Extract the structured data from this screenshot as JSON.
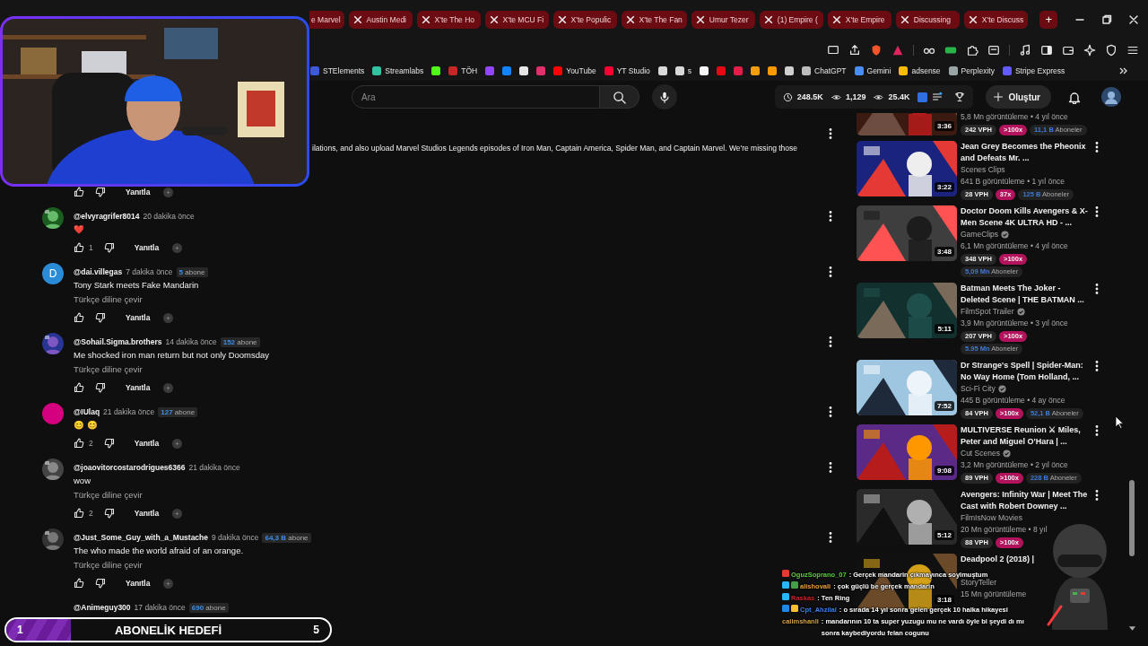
{
  "browser": {
    "tabs": [
      {
        "label": "e Marvel",
        "kind": "cut"
      },
      {
        "label": "Austin Medi",
        "kind": "site"
      },
      {
        "label": "X'te The Ho",
        "kind": "site"
      },
      {
        "label": "X'te MCU Fi",
        "kind": "site"
      },
      {
        "label": "X'te Populic",
        "kind": "site"
      },
      {
        "label": "X'te The Fan",
        "kind": "site"
      },
      {
        "label": "Umur Tezer",
        "kind": "site"
      },
      {
        "label": "(1) Empire (",
        "kind": "site"
      },
      {
        "label": "X'te Empire",
        "kind": "site"
      },
      {
        "label": "Discussing",
        "kind": "site"
      },
      {
        "label": "X'te Discuss",
        "kind": "site"
      }
    ],
    "new_tab": "+",
    "bookmarks": [
      {
        "label": "STElements",
        "color": "#3b5bdb"
      },
      {
        "label": "Streamlabs",
        "color": "#31c3a2"
      },
      {
        "color": "#53fc18"
      },
      {
        "label": "TÖH",
        "color": "#c62828"
      },
      {
        "color": "#9146ff"
      },
      {
        "color": "#1185fe"
      },
      {
        "color": "#e6e6e6"
      },
      {
        "color": "#e1306c"
      },
      {
        "label": "YouTube",
        "color": "#ff0000"
      },
      {
        "label": "YT Studio",
        "color": "#ff0033"
      },
      {
        "color": "#d9d9d9"
      },
      {
        "label": "s",
        "color": "#d9d9d9"
      },
      {
        "color": "#f5f5f5"
      },
      {
        "color": "#e50914"
      },
      {
        "color": "#e11d48"
      },
      {
        "color": "#f59e0b"
      },
      {
        "color": "#ff9900"
      },
      {
        "color": "#cfcfcf"
      },
      {
        "label": "ChatGPT",
        "color": "#bdbdbd"
      },
      {
        "label": "Gemini",
        "color": "#4b8df8"
      },
      {
        "label": "adsense",
        "color": "#fbbc04"
      },
      {
        "label": "Perplexity",
        "color": "#9aa5a6"
      },
      {
        "label": "Stripe Express",
        "color": "#635bff"
      }
    ]
  },
  "masthead": {
    "search": {
      "placeholder": "Ara"
    },
    "stats": [
      {
        "kind": "clock",
        "value": "248.5K"
      },
      {
        "kind": "eye",
        "value": "1,129"
      },
      {
        "kind": "eye",
        "value": "25.4K"
      }
    ],
    "create": "Oluştur"
  },
  "comments": [
    {
      "text": "ilations, and also upload Marvel Studios Legends episodes of Iron Man, Captain America, Spider Man, and Captain Marvel. We're missing those",
      "reply": "Yanıtla",
      "menu": true
    },
    {
      "author": "@elvyragrifer8014",
      "time": "20 dakika önce",
      "text": "❤️",
      "likes": "1",
      "reply": "Yanıtla",
      "menu": true
    },
    {
      "author": "@dai.villegas",
      "time": "7 dakika önce",
      "subscribers": {
        "count": "5",
        "unit": "abone"
      },
      "avatar": {
        "kind": "letter",
        "letter": "D",
        "color": "#2a8bd6"
      },
      "text": "Tony Stark meets Fake Mandarin",
      "translate": "Türkçe diline çevir",
      "reply": "Yanıtla",
      "menu": true
    },
    {
      "author": "@Sohail.Sigma.brothers",
      "time": "14 dakika önce",
      "subscribers": {
        "count": "152",
        "unit": "abone"
      },
      "text": "Me shocked iron man return but not only Doomsday",
      "translate": "Türkçe diline çevir",
      "reply": "Yanıtla",
      "menu": true
    },
    {
      "author": "@IUlaq",
      "time": "21 dakika önce",
      "subscribers": {
        "count": "127",
        "unit": "abone"
      },
      "avatar": {
        "kind": "plain",
        "color": "#d5007f"
      },
      "text": "😊 😊",
      "likes": "2",
      "reply": "Yanıtla",
      "menu": true
    },
    {
      "author": "@joaovitorcostarodrigues6366",
      "time": "21 dakika önce",
      "text": "wow",
      "translate": "Türkçe diline çevir",
      "likes": "2",
      "reply": "Yanıtla",
      "menu": true
    },
    {
      "author": "@Just_Some_Guy_with_a_Mustache",
      "time": "9 dakika önce",
      "subscribers": {
        "count": "64,3 B",
        "unit": "abone"
      },
      "text": "The who made the world afraid of an orange.",
      "translate": "Türkçe diline çevir",
      "reply": "Yanıtla",
      "menu": true
    },
    {
      "author": "@Animeguy300",
      "time": "17 dakika önce",
      "subscribers": {
        "count": "690",
        "unit": "abone"
      },
      "menu": false
    }
  ],
  "videos": [
    {
      "duration": "3:36",
      "meta": "5,8 Mn görüntüleme • 4 yıl önce",
      "vph": "242 VPH",
      "multiplier": ">100x",
      "subs_count": "11,1 B",
      "subs_unit": "Aboneler",
      "menu": false
    },
    {
      "title": "Jean Grey Becomes the Pheonix and Defeats Mr. ...",
      "channel": "Scenes Clips",
      "verified": false,
      "duration": "3:22",
      "meta": "641 B görüntüleme • 1 yıl önce",
      "vph": "28 VPH",
      "multiplier": "37x",
      "subs_count": "125 B",
      "subs_unit": "Aboneler",
      "menu": true
    },
    {
      "title": "Doctor Doom Kills Avengers & X-Men Scene 4K ULTRA HD - ...",
      "channel": "GameClips",
      "verified": true,
      "duration": "3:48",
      "meta": "6,1 Mn görüntüleme • 4 yıl önce",
      "vph": "348 VPH",
      "multiplier": ">100x",
      "subs_count": "5,09 Mn",
      "subs_unit": "Aboneler",
      "menu": true
    },
    {
      "title": "Batman Meets The Joker - Deleted Scene | THE BATMAN ...",
      "channel": "FilmSpot Trailer",
      "verified": true,
      "duration": "5:11",
      "meta": "3,9 Mn görüntüleme • 3 yıl önce",
      "vph": "207 VPH",
      "multiplier": ">100x",
      "subs_count": "5.95 Mn",
      "subs_unit": "Aboneler",
      "menu": true
    },
    {
      "title": "Dr Strange's Spell | Spider-Man: No Way Home (Tom Holland, ...",
      "channel": "Sci-Fi City",
      "verified": true,
      "duration": "7:52",
      "meta": "445 B görüntüleme • 4 ay önce",
      "vph": "84 VPH",
      "multiplier": ">100x",
      "subs_count": "52,1 B",
      "subs_unit": "Aboneler",
      "menu": true
    },
    {
      "title": "MULTIVERSE Reunion ⚔ Miles, Peter and Miguel O'Hara | ...",
      "channel": "Cut Scenes",
      "verified": true,
      "duration": "9:08",
      "meta": "3,2 Mn görüntüleme • 2 yıl önce",
      "vph": "89 VPH",
      "multiplier": ">100x",
      "subs_count": "228 B",
      "subs_unit": "Aboneler",
      "menu": true
    },
    {
      "title": "Avengers: Infinity War | Meet The Cast with Robert Downey ...",
      "channel": "FilmIsNow Movies",
      "verified": false,
      "duration": "5:12",
      "meta": "20 Mn görüntüleme • 8 yıl",
      "vph": "88 VPH",
      "multiplier": ">100x",
      "menu": true
    },
    {
      "title": "Deadpool 2 (2018) |",
      "channel": "StoryTeller",
      "verified": false,
      "duration": "3:18",
      "meta": "15 Mn görüntüleme",
      "menu": false
    }
  ],
  "chat": [
    {
      "user": "OguzSoprano_07",
      "color": "#5bd23c",
      "badges": [
        {
          "color": "#e53935"
        }
      ],
      "message": ": Gerçek mandarin çıkmayınca soylmuştum"
    },
    {
      "user": "alishovali",
      "color": "#e9a23b",
      "badges": [
        {
          "color": "#29b6f6"
        },
        {
          "color": "#43a047"
        }
      ],
      "message": ": çok güçlü be gerçek mandarin"
    },
    {
      "user": "Raskas",
      "color": "#c62828",
      "badges": [
        {
          "color": "#29b6f6"
        }
      ],
      "message": ": Ten Ring"
    },
    {
      "user": "Cpt_Ahzilal",
      "color": "#3b82f6",
      "badges": [
        {
          "color": "#1e88e5"
        },
        {
          "color": "#fbc02d"
        }
      ],
      "message": ": o sırada 14 yıl sonra gelen gerçek 10 halka hikayesi"
    },
    {
      "user": "calimshanli",
      "color": "#d6a24c",
      "message": ": mandarının 10 ta super yuzugu mu ne vardı öyle bi şeydi dı mı sonra kaybediyordu felan cogunu"
    }
  ],
  "goal": {
    "start": "1",
    "title": "ABONELİK HEDEFİ",
    "end": "5",
    "level": 0.2
  }
}
